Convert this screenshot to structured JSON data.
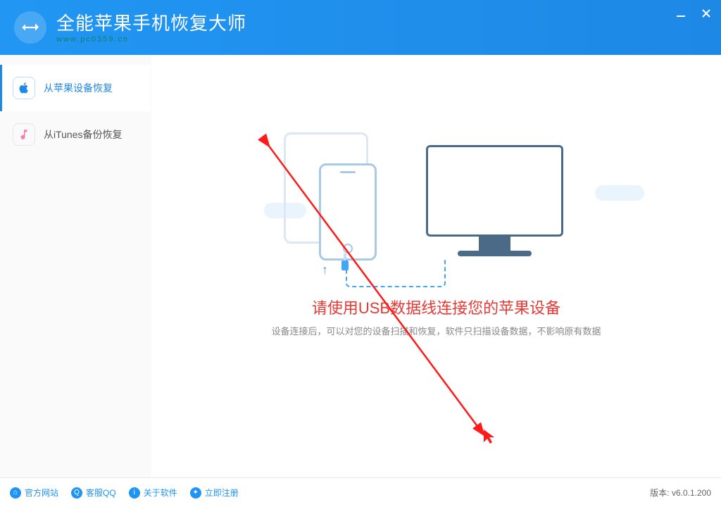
{
  "header": {
    "title": "全能苹果手机恢复大师",
    "subtitle": "www.pc0359.cn"
  },
  "sidebar": {
    "items": [
      {
        "label": "从苹果设备恢复",
        "icon": "apple-icon",
        "active": true
      },
      {
        "label": "从iTunes备份恢复",
        "icon": "music-note-icon",
        "active": false
      }
    ]
  },
  "main": {
    "primary_message": "请使用USB数据线连接您的苹果设备",
    "secondary_message": "设备连接后，可以对您的设备扫描和恢复，软件只扫描设备数据，不影响原有数据"
  },
  "footer": {
    "links": [
      {
        "label": "官方网站",
        "icon": "home-icon"
      },
      {
        "label": "客服QQ",
        "icon": "qq-icon"
      },
      {
        "label": "关于软件",
        "icon": "info-icon"
      },
      {
        "label": "立即注册",
        "icon": "user-icon"
      }
    ],
    "version_label": "版本: v6.0.1.200"
  }
}
